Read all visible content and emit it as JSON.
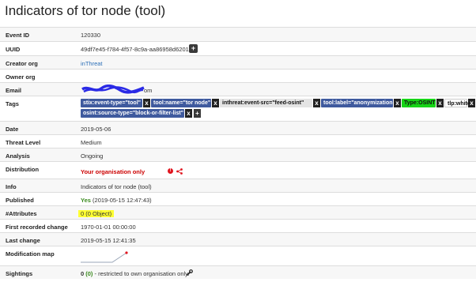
{
  "page": {
    "title": "Indicators of tor node (tool)"
  },
  "fields": {
    "event_id": {
      "label": "Event ID",
      "value": "120330"
    },
    "uuid": {
      "label": "UUID",
      "value": "49df7e45-f784-4f57-8c9a-aa86958d6201",
      "action": "+"
    },
    "creator_org": {
      "label": "Creator org",
      "value": "inThreat"
    },
    "owner_org": {
      "label": "Owner org",
      "value": ""
    },
    "email": {
      "label": "Email",
      "visible_suffix": "om"
    },
    "tags": {
      "label": "Tags",
      "remove": "x",
      "add": "+"
    },
    "date": {
      "label": "Date",
      "value": "2019-05-06"
    },
    "threat_level": {
      "label": "Threat Level",
      "value": "Medium"
    },
    "analysis": {
      "label": "Analysis",
      "value": "Ongoing"
    },
    "distribution": {
      "label": "Distribution",
      "value": "Your organisation only",
      "info": "!"
    },
    "info": {
      "label": "Info",
      "value": "Indicators of tor node (tool)"
    },
    "published": {
      "label": "Published",
      "status": "Yes",
      "date": "(2019-05-15 12:47:43)"
    },
    "attributes": {
      "label": "#Attributes",
      "value": "0 (0 Object)"
    },
    "first_recorded_change": {
      "label": "First recorded change",
      "value": "1970-01-01 00:00:00"
    },
    "last_change": {
      "label": "Last change",
      "value": "2019-05-15 12:41:35"
    },
    "modification_map": {
      "label": "Modification map"
    },
    "sightings": {
      "label": "Sightings",
      "count": "0",
      "inner": "(0)",
      "sep": " - ",
      "note": "restricted to own organisation only."
    }
  },
  "tag_list": [
    {
      "label": "stix:event-type=\"tool\"",
      "color": "#3f5a9e"
    },
    {
      "label": "tool:name=\"tor node\"",
      "color": "#3f5a9e"
    },
    {
      "label": "inthreat:event-src=\"feed-osint\"",
      "color": "#e4e4e4"
    },
    {
      "label": "tool:label=\"anonymization\"",
      "color": "#3f5a9e"
    },
    {
      "label": "Type:OSINT",
      "color": "#17d417"
    },
    {
      "label": "tlp:white",
      "color": "#ffffff"
    },
    {
      "label": "osint:source-type=\"block-or-filter-list\"",
      "color": "#3f5a9e"
    }
  ],
  "colors": {
    "tag_blue": "#3f5a9e",
    "osint_green": "#17d417",
    "distribution_red": "#cc0000",
    "published_green": "#3a8a1e",
    "highlight": "#ffff33",
    "redaction_blue": "#2a2ae6"
  },
  "icons": {
    "add": "plus-icon",
    "remove": "close-icon",
    "distribution_info": "exclamation-circle-icon",
    "distribution_share": "share-nodes-icon",
    "sightings_action": "wrench-icon"
  }
}
